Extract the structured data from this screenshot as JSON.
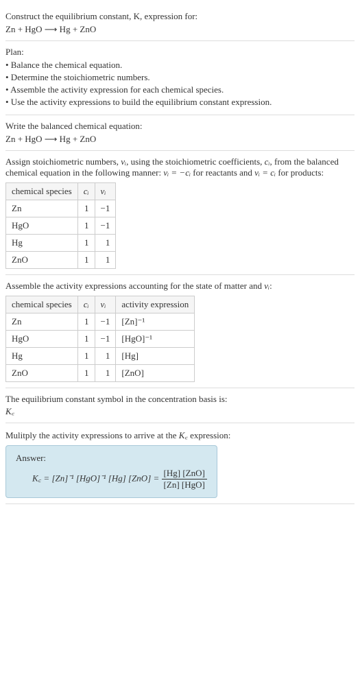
{
  "intro": {
    "line1": "Construct the equilibrium constant, K, expression for:",
    "equation": "Zn + HgO  ⟶  Hg + ZnO"
  },
  "plan": {
    "header": "Plan:",
    "items": [
      "• Balance the chemical equation.",
      "• Determine the stoichiometric numbers.",
      "• Assemble the activity expression for each chemical species.",
      "• Use the activity expressions to build the equilibrium constant expression."
    ]
  },
  "balanced": {
    "text": "Write the balanced chemical equation:",
    "equation": "Zn + HgO  ⟶  Hg + ZnO"
  },
  "stoich": {
    "text_prefix": "Assign stoichiometric numbers, ",
    "nu": "νᵢ",
    "text_mid1": ", using the stoichiometric coefficients, ",
    "ci": "cᵢ",
    "text_mid2": ", from the balanced chemical equation in the following manner: ",
    "rel1": "νᵢ = −cᵢ",
    "text_mid3": " for reactants and ",
    "rel2": "νᵢ = cᵢ",
    "text_end": " for products:",
    "headers": {
      "h1": "chemical species",
      "h2": "cᵢ",
      "h3": "νᵢ"
    },
    "rows": [
      {
        "species": "Zn",
        "c": "1",
        "nu": "−1"
      },
      {
        "species": "HgO",
        "c": "1",
        "nu": "−1"
      },
      {
        "species": "Hg",
        "c": "1",
        "nu": "1"
      },
      {
        "species": "ZnO",
        "c": "1",
        "nu": "1"
      }
    ]
  },
  "activity": {
    "text_prefix": "Assemble the activity expressions accounting for the state of matter and ",
    "nu": "νᵢ",
    "text_end": ":",
    "headers": {
      "h1": "chemical species",
      "h2": "cᵢ",
      "h3": "νᵢ",
      "h4": "activity expression"
    },
    "rows": [
      {
        "species": "Zn",
        "c": "1",
        "nu": "−1",
        "act": "[Zn]⁻¹"
      },
      {
        "species": "HgO",
        "c": "1",
        "nu": "−1",
        "act": "[HgO]⁻¹"
      },
      {
        "species": "Hg",
        "c": "1",
        "nu": "1",
        "act": "[Hg]"
      },
      {
        "species": "ZnO",
        "c": "1",
        "nu": "1",
        "act": "[ZnO]"
      }
    ]
  },
  "symbol": {
    "text": "The equilibrium constant symbol in the concentration basis is:",
    "val": "K꜀"
  },
  "multiply": {
    "text_prefix": "Mulitply the activity expressions to arrive at the ",
    "kc": "K꜀",
    "text_end": " expression:"
  },
  "answer": {
    "label": "Answer:",
    "lhs": "K꜀ = [Zn]⁻¹ [HgO]⁻¹ [Hg] [ZnO] = ",
    "frac_num": "[Hg] [ZnO]",
    "frac_den": "[Zn] [HgO]"
  }
}
